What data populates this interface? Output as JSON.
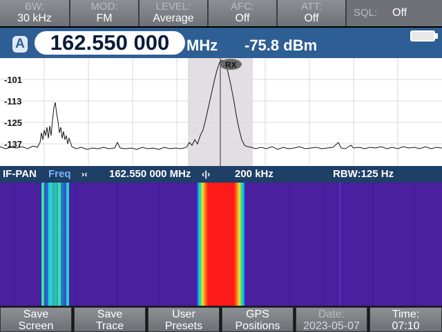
{
  "top_bar": {
    "params": [
      {
        "label": "BW:",
        "value": "30 kHz"
      },
      {
        "label": "MOD:",
        "value": "FM"
      },
      {
        "label": "LEVEL:",
        "value": "Average"
      },
      {
        "label": "AFC:",
        "value": "Off"
      },
      {
        "label": "ATT:",
        "value": "Off"
      }
    ],
    "sql": {
      "label": "SQL:",
      "value": "Off"
    }
  },
  "freq_bar": {
    "channel": "A",
    "frequency": "162.550 000",
    "unit": "MHz",
    "level": "-75.8 dBm",
    "battery_icon": "battery-icon"
  },
  "spectrum": {
    "marker_label": "RX",
    "y_ticks": [
      "-101",
      "-113",
      "-125",
      "-137"
    ]
  },
  "ifpan_bar": {
    "mode": "IF-PAN",
    "freq_label": "Freq",
    "center_icon": "center-freq-icon",
    "center_freq": "162.550 000 MHz",
    "span_icon": "span-icon",
    "span": "200 kHz",
    "rbw": "RBW:125 Hz"
  },
  "softkeys": [
    {
      "line1": "Save",
      "line2": "Screen"
    },
    {
      "line1": "Save",
      "line2": "Trace"
    },
    {
      "line1": "User",
      "line2": "Presets"
    },
    {
      "line1": "GPS",
      "line2": "Positions"
    },
    {
      "line1": "Date:",
      "line2": "2023-05-07"
    },
    {
      "line1": "Time:",
      "line2": "07:10"
    }
  ],
  "colors": {
    "accent": "#2e5f94",
    "panel_gray": "#7f8388"
  }
}
